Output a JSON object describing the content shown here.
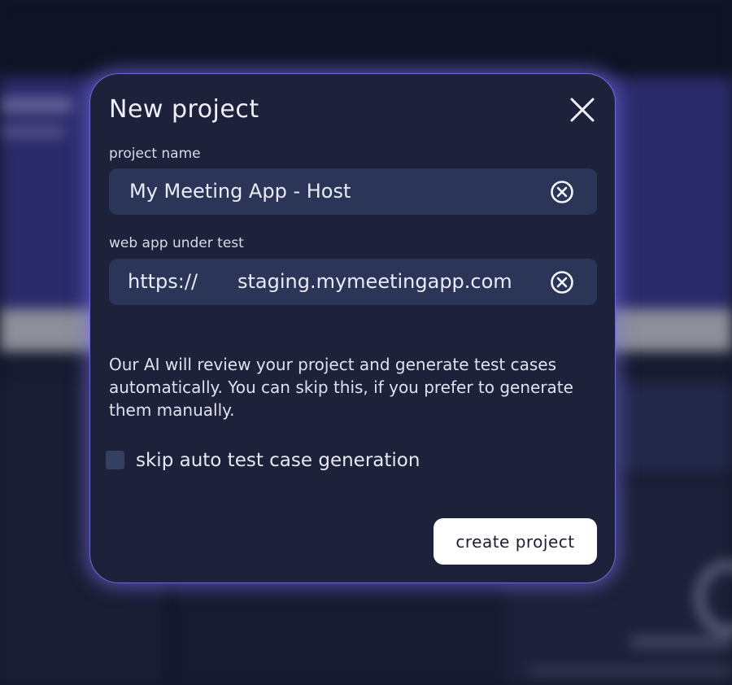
{
  "modal": {
    "title": "New project",
    "close_icon": "close-icon",
    "project_name": {
      "label": "project name",
      "value": "My Meeting App - Host",
      "clear_icon": "clear-circle-x-icon"
    },
    "web_app": {
      "label": "web app under test",
      "prefix": "https://",
      "value": "staging.mymeetingapp.com",
      "clear_icon": "clear-circle-x-icon"
    },
    "info_text": "Our AI will review your project and generate test cases automatically. You can skip this, if you prefer to generate them manually.",
    "skip_checkbox": {
      "label": "skip auto test case generation",
      "checked": false
    },
    "create_button": "create project"
  },
  "colors": {
    "modal_bg": "#1d2139",
    "modal_glow": "#6b6bd0",
    "input_bg": "#2b3557",
    "button_bg": "#ffffff"
  }
}
